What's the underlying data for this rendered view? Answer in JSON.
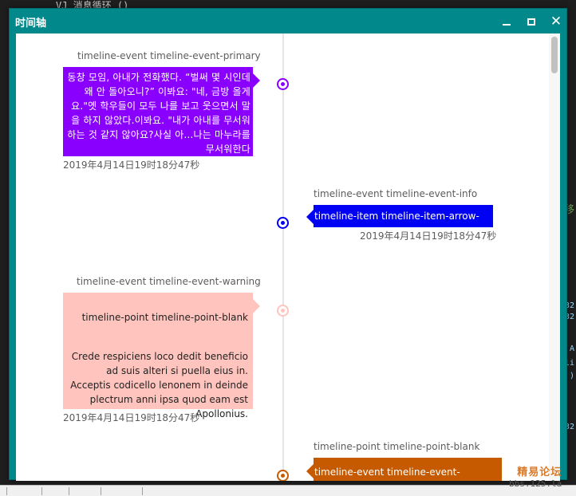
{
  "background": {
    "top_text": "VJ 消息循环 ()",
    "right_glyphs": [
      "移",
      "32",
      "32",
      "A",
      "li",
      ")",
      "32"
    ]
  },
  "window": {
    "title": "时间轴",
    "close_glyph": "✕"
  },
  "colors": {
    "titlebar": "#00888a",
    "primary": "#8a00ff",
    "info": "#0000f5",
    "warning": "#ffc4bd",
    "blank": "#c55a00"
  },
  "events": [
    {
      "title": "timeline-event timeline-event-primary",
      "body": "동창 모임, 아내가 전화했다. “벌써 몇 시인데 왜 안 돌아오니?” 이봐요: \"네, 금방 올게요.\"옛 학우들이 모두 나를 보고 웃으면서 말을 하지 않았다.이봐요. \"내가 아내를 무서워하는 것 같지 않아요?사실 아...나는 마누라를 무서워한다",
      "time": "2019年4月14日19时18分47秒"
    },
    {
      "title": "timeline-event timeline-event-info",
      "body": "timeline-item timeline-item-arrow-sm",
      "time": "2019年4月14日19时18分47秒"
    },
    {
      "title": "timeline-event timeline-event-warning",
      "body_title": "timeline-point timeline-point-blank",
      "body": "Crede respiciens loco dedit beneficio ad suis alteri si puella eius in. Acceptis codicello lenonem in deinde plectrum anni ipsa quod eam est Apollonius.",
      "time": "2019年4月14日19时18分47秒"
    },
    {
      "title": "timeline-point timeline-point-blank",
      "body": "timeline-event timeline-event-primary"
    }
  ],
  "watermark": {
    "top": "精易论坛",
    "bottom": "bbs.125.la"
  }
}
